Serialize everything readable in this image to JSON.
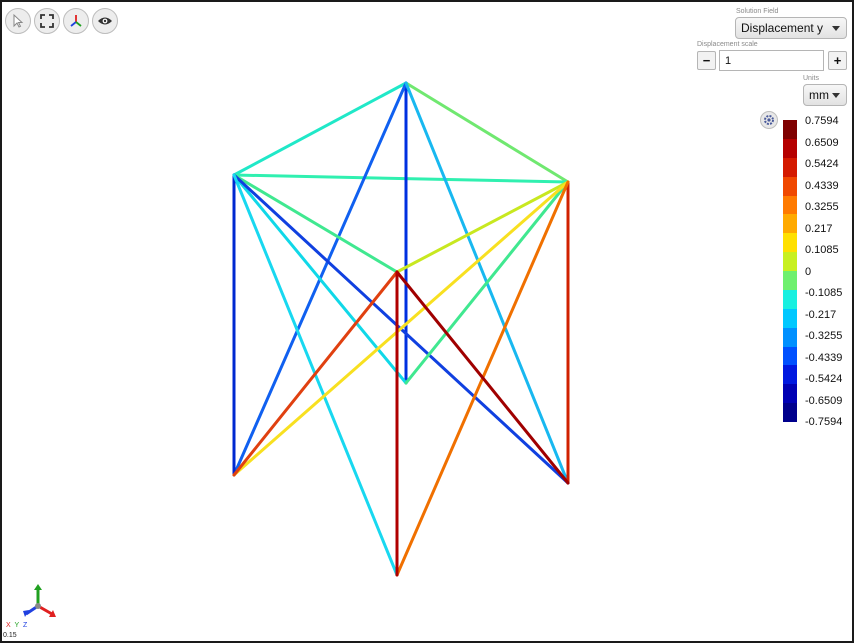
{
  "toolbar": {
    "items": [
      {
        "name": "select-cursor-icon",
        "interactable": true
      },
      {
        "name": "fit-view-icon",
        "interactable": true
      },
      {
        "name": "axes-view-icon",
        "interactable": true
      },
      {
        "name": "eye-icon",
        "interactable": true
      }
    ]
  },
  "solution_field": {
    "caption": "Solution Field",
    "value": "Displacement y"
  },
  "displacement_scale": {
    "caption": "Displacement scale",
    "value": "1",
    "minus_label": "−",
    "plus_label": "+"
  },
  "units": {
    "caption": "Units",
    "value": "mm"
  },
  "legend": {
    "ticks": [
      "0.7594",
      "0.6509",
      "0.5424",
      "0.4339",
      "0.3255",
      "0.217",
      "0.1085",
      "0",
      "-0.1085",
      "-0.217",
      "-0.3255",
      "-0.4339",
      "-0.5424",
      "-0.6509",
      "-0.7594"
    ],
    "colors": [
      "#7f0000",
      "#b50000",
      "#d41a00",
      "#f04800",
      "#ff7a00",
      "#ffaa00",
      "#ffe000",
      "#c8f020",
      "#6ef06e",
      "#18f0e0",
      "#00c8ff",
      "#0090ff",
      "#0050ff",
      "#0018e0",
      "#0000b4",
      "#00008c"
    ]
  },
  "axes": {
    "label_x": "X",
    "label_y": "Y",
    "label_z": "Z",
    "color_x": "#e02020",
    "color_y": "#20a020",
    "color_z": "#2040e0"
  },
  "corner_text": "0.15"
}
